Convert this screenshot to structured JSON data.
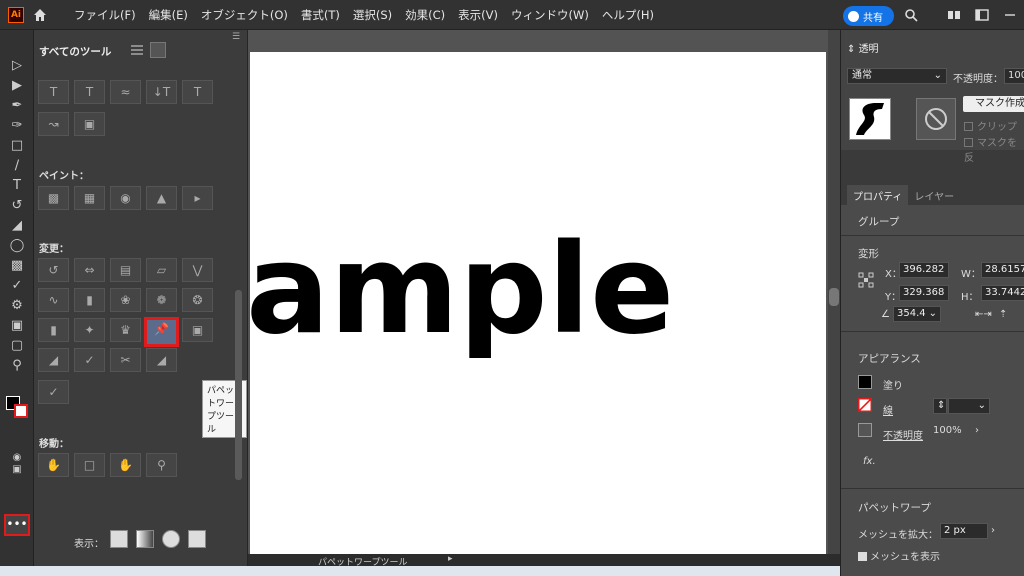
{
  "app": {
    "logo": "Ai"
  },
  "menu": [
    "ファイル(F)",
    "編集(E)",
    "オブジェクト(O)",
    "書式(T)",
    "選択(S)",
    "効果(C)",
    "表示(V)",
    "ウィンドウ(W)",
    "ヘルプ(H)"
  ],
  "share": {
    "label": "共有"
  },
  "tools_panel": {
    "title": "すべてのツール",
    "sections": {
      "paint": "ペイント：",
      "transform": "変更：",
      "move": "移動："
    },
    "tooltip": "パペットワープツール",
    "display_label": "表示："
  },
  "statusbar": {
    "tool_name": "パペットワープツール"
  },
  "artwork_text": "ample",
  "transparency": {
    "tab": "透明",
    "blend_mode": "通常",
    "opacity_label": "不透明度：",
    "opacity_value": "100",
    "mask_button": "マスク作成",
    "clip_label": "クリップ",
    "invert_label": "マスクを反"
  },
  "properties": {
    "tab_properties": "プロパティ",
    "tab_layers": "レイヤー",
    "object_type": "グループ",
    "transform_label": "変形",
    "x_label": "X：",
    "x_value": "396.282",
    "y_label": "Y：",
    "y_value": "329.368",
    "w_label": "W：",
    "w_value": "28.6157",
    "h_label": "H：",
    "h_value": "33.7442",
    "angle_value": "354.4",
    "appearance_label": "アピアランス",
    "fill_label": "塗り",
    "stroke_label": "線",
    "opacity_label": "不透明度",
    "opacity_value": "100%",
    "fx_label": "fx.",
    "puppet_label": "パペットワープ",
    "mesh_expand_label": "メッシュを拡大：",
    "mesh_expand_value": "2 px",
    "show_mesh_label": "メッシュを表示"
  }
}
